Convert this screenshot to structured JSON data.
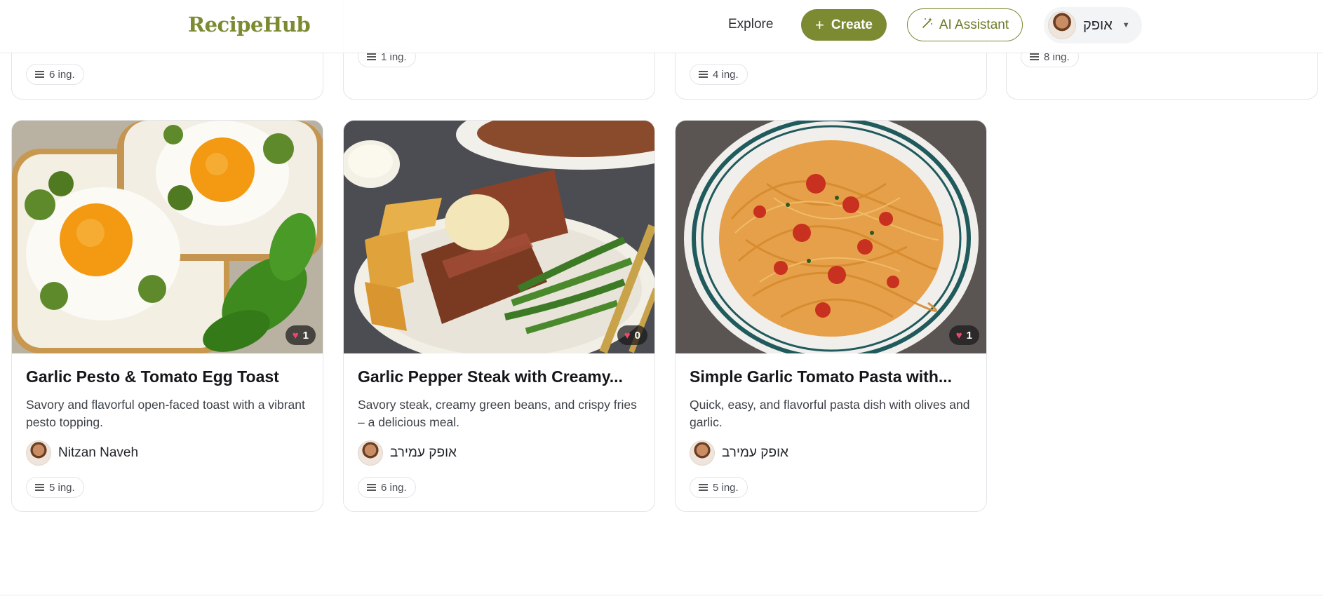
{
  "header": {
    "logo": "RecipeHub",
    "nav_explore": "Explore",
    "create_label": "Create",
    "create_icon": "plus-icon",
    "ai_label": "AI Assistant",
    "ai_icon": "sparkle-icon",
    "user_name": "אופק",
    "user_caret_icon": "caret-down-icon"
  },
  "top_row": [
    {
      "ingredients": "6 ing."
    },
    {
      "ingredients": "1 ing."
    },
    {
      "ingredients": "4 ing."
    },
    {
      "ingredients": "8 ing."
    }
  ],
  "recipes": [
    {
      "title": "Garlic Pesto & Tomato Egg Toast",
      "description": "Savory and flavorful open-faced toast with a vibrant pesto topping.",
      "author": "Nitzan Naveh",
      "likes": "1",
      "ingredients": "5 ing."
    },
    {
      "title": "Garlic Pepper Steak with Creamy...",
      "description": "Savory steak, creamy green beans, and crispy fries – a delicious meal.",
      "author": "אופק עמירב",
      "likes": "0",
      "ingredients": "6 ing."
    },
    {
      "title": "Simple Garlic Tomato Pasta with...",
      "description": "Quick, easy, and flavorful pasta dish with olives and garlic.",
      "author": "אופק עמירב",
      "likes": "1",
      "ingredients": "5 ing."
    }
  ],
  "colors": {
    "brand": "#7c8a32",
    "like_heart": "#f0456a"
  }
}
